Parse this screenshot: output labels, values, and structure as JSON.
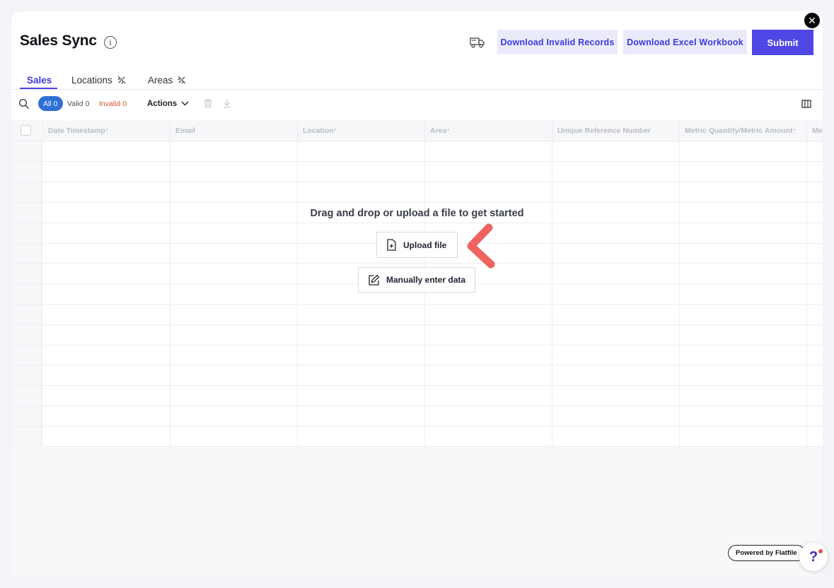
{
  "header": {
    "title": "Sales Sync",
    "info_icon": "info-icon",
    "close_icon": "close-icon",
    "truck_icon": "truck-icon",
    "buttons": {
      "download_invalid": "Download Invalid Records",
      "download_excel": "Download Excel Workbook",
      "submit": "Submit"
    }
  },
  "tabs": [
    {
      "label": "Sales",
      "active": true
    },
    {
      "label": "Locations",
      "icon": "unlink-icon"
    },
    {
      "label": "Areas",
      "icon": "unlink-icon"
    }
  ],
  "toolbar": {
    "filters": {
      "all_label": "All",
      "all_count": "0",
      "valid_label": "Valid",
      "valid_count": "0",
      "invalid_label": "Invalid",
      "invalid_count": "0"
    },
    "actions_label": "Actions"
  },
  "grid": {
    "columns": [
      {
        "label": "Date Timestamp",
        "required": "*"
      },
      {
        "label": "Email",
        "required": ""
      },
      {
        "label": "Location",
        "required": "*"
      },
      {
        "label": "Area",
        "required": "*"
      },
      {
        "label": "Unique Reference Number",
        "required": ""
      },
      {
        "label": "Metric Quantity/Metric Amount",
        "required": "*"
      },
      {
        "label": "Met",
        "required": ""
      }
    ]
  },
  "empty_state": {
    "message": "Drag and drop or upload a file to get started",
    "upload_label": "Upload file",
    "manual_label": "Manually enter data"
  },
  "footer": {
    "powered_by": "Powered by Flatfile",
    "help_symbol": "?"
  },
  "colors": {
    "accent": "#4f46e5",
    "accent_light": "#eaeafb",
    "invalid": "#d3502c",
    "annotation_arrow": "#f0625e"
  }
}
